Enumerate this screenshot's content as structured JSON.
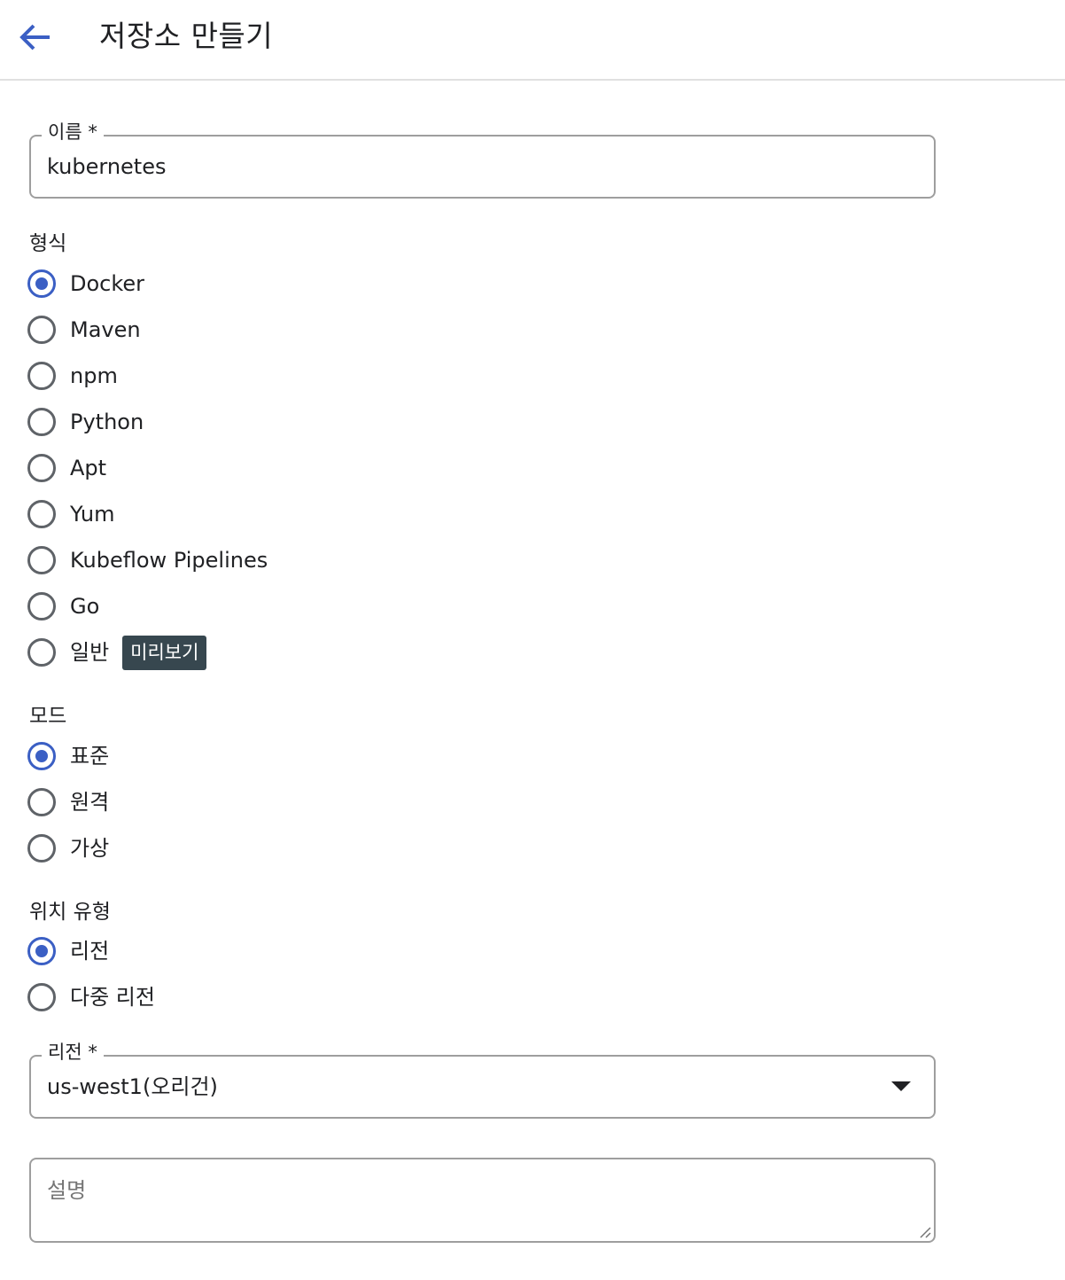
{
  "header": {
    "title": "저장소 만들기",
    "back_icon": "arrow-back-icon"
  },
  "name_field": {
    "label": "이름 *",
    "value": "kubernetes"
  },
  "format": {
    "label": "형식",
    "options": [
      {
        "label": "Docker",
        "checked": true
      },
      {
        "label": "Maven",
        "checked": false
      },
      {
        "label": "npm",
        "checked": false
      },
      {
        "label": "Python",
        "checked": false
      },
      {
        "label": "Apt",
        "checked": false
      },
      {
        "label": "Yum",
        "checked": false
      },
      {
        "label": "Kubeflow Pipelines",
        "checked": false
      },
      {
        "label": "Go",
        "checked": false
      },
      {
        "label": "일반",
        "checked": false,
        "badge": "미리보기"
      }
    ]
  },
  "mode": {
    "label": "모드",
    "options": [
      {
        "label": "표준",
        "checked": true
      },
      {
        "label": "원격",
        "checked": false
      },
      {
        "label": "가상",
        "checked": false
      }
    ]
  },
  "location_type": {
    "label": "위치 유형",
    "options": [
      {
        "label": "리전",
        "checked": true
      },
      {
        "label": "다중 리전",
        "checked": false
      }
    ]
  },
  "region_field": {
    "label": "리전 *",
    "value": "us-west1(오리건)"
  },
  "description_field": {
    "placeholder": "설명"
  },
  "colors": {
    "accent": "#3b5fc4",
    "badge_bg": "#37474f",
    "border": "#9e9e9e"
  }
}
